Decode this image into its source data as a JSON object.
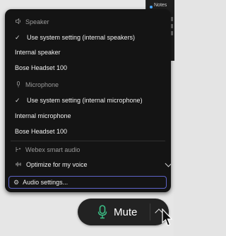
{
  "background": {
    "thumbnail_label": "Notes"
  },
  "menu": {
    "speaker": {
      "heading": "Speaker",
      "heading_icon": "speaker-icon",
      "options": [
        {
          "label": "Use system setting (internal speakers)",
          "selected": true
        },
        {
          "label": "Internal speaker",
          "selected": false
        },
        {
          "label": "Bose Headset 100",
          "selected": false
        }
      ]
    },
    "microphone": {
      "heading": "Microphone",
      "heading_icon": "microphone-icon",
      "options": [
        {
          "label": "Use system setting (internal microphone)",
          "selected": true
        },
        {
          "label": "Internal microphone",
          "selected": false
        },
        {
          "label": "Bose Headset 100",
          "selected": false
        }
      ]
    },
    "smart_audio": {
      "heading": "Webex smart audio",
      "heading_icon": "smart-audio-icon",
      "selected": "Optimize for my voice",
      "selected_icon": "voice-waveform-icon"
    },
    "audio_settings_label": "Audio settings...",
    "audio_settings_icon": "gear-icon",
    "accent_color": "#5e64c8"
  },
  "mute_control": {
    "label": "Mute",
    "mic_color": "#3bbf86",
    "icon": "microphone-icon",
    "chevron_icon": "chevron-up-icon"
  }
}
